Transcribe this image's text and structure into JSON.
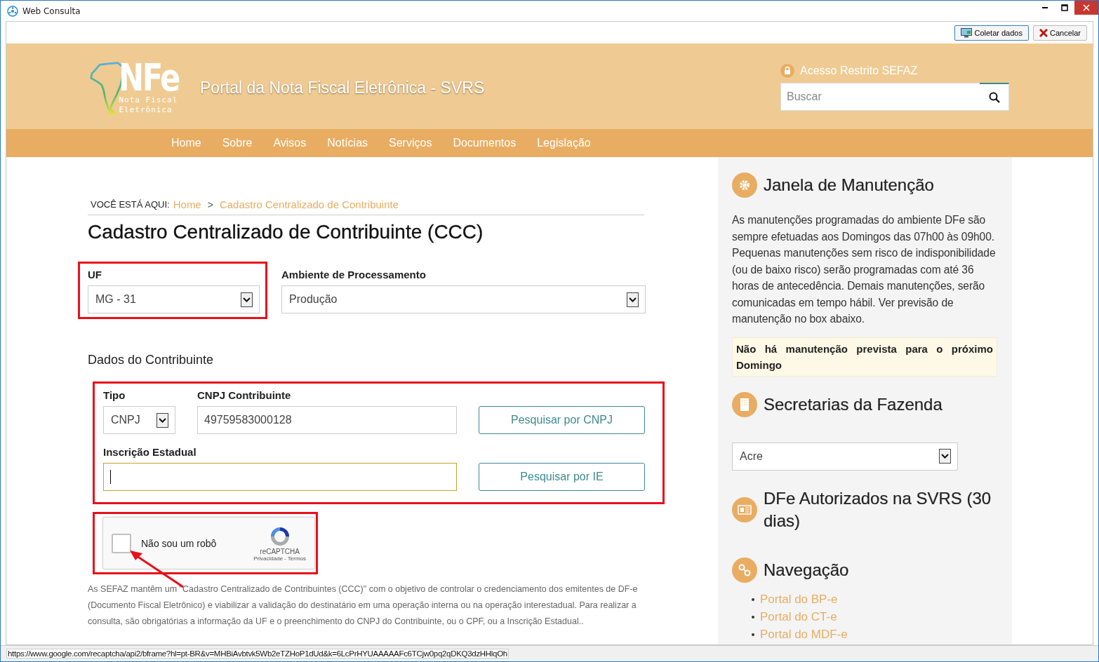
{
  "window": {
    "title": "Web Consulta"
  },
  "toolbar": {
    "buttons": [
      {
        "label": "Coletar dados",
        "kind": "collect"
      },
      {
        "label": "Cancelar",
        "kind": "cancel"
      }
    ]
  },
  "header": {
    "logo_text": "NFe",
    "logo_subtitle": [
      "Nota Fiscal",
      "Eletrônica"
    ],
    "portal_title": "Portal da Nota Fiscal Eletrônica - SVRS",
    "restricted_access": "Acesso Restrito SEFAZ",
    "search": {
      "placeholder": "Buscar"
    }
  },
  "nav": {
    "items": [
      "Home",
      "Sobre",
      "Avisos",
      "Notícias",
      "Serviços",
      "Documentos",
      "Legislação"
    ]
  },
  "breadcrumb": {
    "label": "VOCÊ ESTÁ AQUI:",
    "separator": ">",
    "items": [
      "Home",
      "Cadastro Centralizado de Contribuinte"
    ]
  },
  "page_title": "Cadastro Centralizado de Contribuinte (CCC)",
  "form": {
    "uf": {
      "label": "UF",
      "value": "MG - 31",
      "highlighted": true
    },
    "environment": {
      "label": "Ambiente de Processamento",
      "value": "Produção"
    },
    "section_title": "Dados do Contribuinte",
    "contributor_highlighted": true,
    "type": {
      "label": "Tipo",
      "value": "CNPJ"
    },
    "cnpj": {
      "label": "CNPJ Contribuinte",
      "value": "49759583000128"
    },
    "search_cnpj_button": "Pesquisar por CNPJ",
    "ie": {
      "label": "Inscrição Estadual",
      "focused": true
    },
    "search_ie_button": "Pesquisar por IE"
  },
  "captcha": {
    "label": "Não sou um robô",
    "checked": false,
    "highlighted": true,
    "brand": "reCAPTCHA",
    "links": [
      "Privacidade",
      "Termos"
    ],
    "link_separator": "-"
  },
  "description": "As SEFAZ mantêm um \"Cadastro Centralizado de Contribuintes (CCC)\" com o objetivo de controlar o credenciamento dos emitentes de DF-e (Documento Fiscal Eletrônico) e viabilizar a validação do destinatário em uma operação interna ou na operação interestadual. Para realizar a consulta, são obrigatórias a informação da UF e o preenchimento do CNPJ do Contribuinte, ou o CPF, ou a Inscrição Estadual..",
  "sidebar": {
    "sections": [
      {
        "kind": "maintenance",
        "title": "Janela de Manutenção",
        "text": "As manutenções programadas do ambiente DFe são sempre efetuadas aos Domingos das 07h00 às 09h00. Pequenas manutenções sem risco de indisponibilidade (ou de baixo risco) serão programadas com até 36 horas de antecedência. Demais manutenções, serão comunicadas em tempo hábil. Ver previsão de manutenção no box abaixo.",
        "notice": "Não há manutenção prevista para o próximo Domingo"
      },
      {
        "kind": "select",
        "title": "Secretarias da Fazenda",
        "value": "Acre"
      },
      {
        "kind": "heading",
        "title": "DFe Autorizados na SVRS (30 dias)"
      },
      {
        "kind": "links",
        "title": "Navegação",
        "links": [
          "Portal do BP-e",
          "Portal do CT-e",
          "Portal do MDF-e"
        ]
      }
    ]
  },
  "status_bar": {
    "text": "https://www.google.com/recaptcha/api2/bframe?hl=pt-BR&v=MHBiAvbtvk5Wb2eTZHoP1dUd&k=6LcPrHYUAAAAAFc6TCjw0pq2qDKQ3dzHHlqOh"
  }
}
